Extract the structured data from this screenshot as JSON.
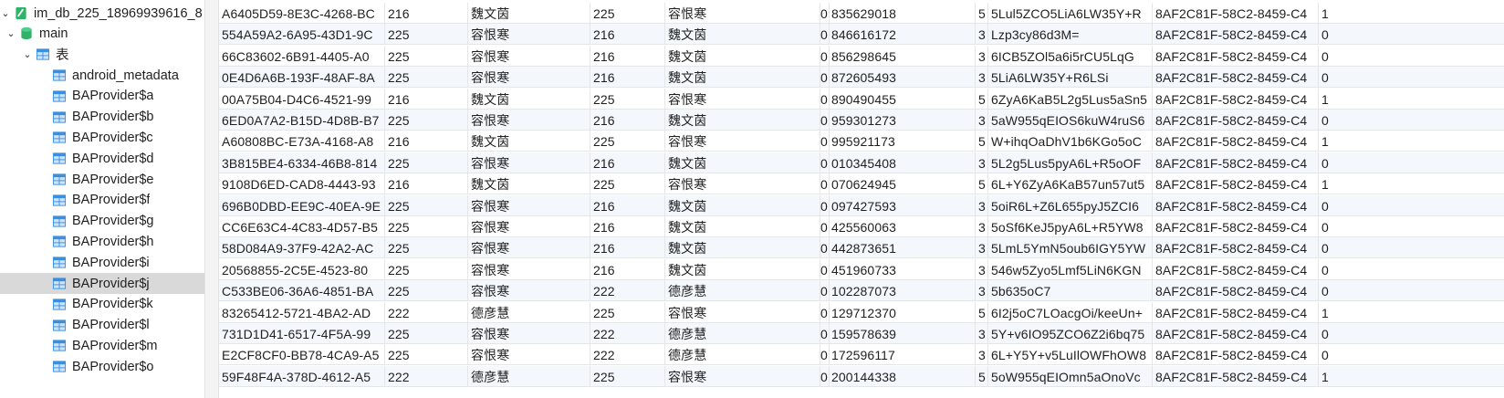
{
  "sidebar": {
    "database": "im_db_225_18969939616_8",
    "schema": "main",
    "tables_folder": "表",
    "tables": [
      "android_metadata",
      "BAProvider$a",
      "BAProvider$b",
      "BAProvider$c",
      "BAProvider$d",
      "BAProvider$e",
      "BAProvider$f",
      "BAProvider$g",
      "BAProvider$h",
      "BAProvider$i",
      "BAProvider$j",
      "BAProvider$k",
      "BAProvider$l",
      "BAProvider$m",
      "BAProvider$o"
    ],
    "selected_table": "BAProvider$j"
  },
  "colors": {
    "selected_bg": "#d9d9d9",
    "alt_row_bg": "#f4f7fb",
    "db_icon": "#2fb36b",
    "table_icon": "#3b8fe0"
  },
  "rows": [
    [
      "A6405D59-8E3C-4268-BC",
      "216",
      "魏文茵",
      "225",
      "容恨寒",
      "0",
      "835629018",
      "5",
      "5Lul5ZCO5LiA6LW35Y+R",
      "8AF2C81F-58C2-8459-C4",
      "1"
    ],
    [
      "554A59A2-6A95-43D1-9C",
      "225",
      "容恨寒",
      "216",
      "魏文茵",
      "0",
      "846616172",
      "3",
      "Lzp3cy86d3M=",
      "8AF2C81F-58C2-8459-C4",
      "0"
    ],
    [
      "66C83602-6B91-4405-A0",
      "225",
      "容恨寒",
      "216",
      "魏文茵",
      "0",
      "856298645",
      "3",
      "6ICB5ZOl5a6i5rCU5LqG",
      "8AF2C81F-58C2-8459-C4",
      "0"
    ],
    [
      "0E4D6A6B-193F-48AF-8A",
      "225",
      "容恨寒",
      "216",
      "魏文茵",
      "0",
      "872605493",
      "3",
      "5LiA6LW35Y+R6LSi",
      "8AF2C81F-58C2-8459-C4",
      "0"
    ],
    [
      "00A75B04-D4C6-4521-99",
      "216",
      "魏文茵",
      "225",
      "容恨寒",
      "0",
      "890490455",
      "5",
      "6ZyA6KaB5L2g5Lus5aSn5",
      "8AF2C81F-58C2-8459-C4",
      "1"
    ],
    [
      "6ED0A7A2-B15D-4D8B-B7",
      "225",
      "容恨寒",
      "216",
      "魏文茵",
      "0",
      "959301273",
      "3",
      "5aW955qEIOS6kuW4ruS6",
      "8AF2C81F-58C2-8459-C4",
      "0"
    ],
    [
      "A60808BC-E73A-4168-A8",
      "216",
      "魏文茵",
      "225",
      "容恨寒",
      "0",
      "995921173",
      "5",
      "W+ihqOaDhV1b6KGo5oC",
      "8AF2C81F-58C2-8459-C4",
      "1"
    ],
    [
      "3B815BE4-6334-46B8-814",
      "225",
      "容恨寒",
      "216",
      "魏文茵",
      "0",
      "010345408",
      "3",
      "5L2g5Lus5pyA6L+R5oOF",
      "8AF2C81F-58C2-8459-C4",
      "0"
    ],
    [
      "9108D6ED-CAD8-4443-93",
      "216",
      "魏文茵",
      "225",
      "容恨寒",
      "0",
      "070624945",
      "5",
      "6L+Y6ZyA6KaB57un57ut5",
      "8AF2C81F-58C2-8459-C4",
      "1"
    ],
    [
      "696B0DBD-EE9C-40EA-9E",
      "225",
      "容恨寒",
      "216",
      "魏文茵",
      "0",
      "097427593",
      "3",
      "5oiR6L+Z6L655pyJ5ZCI6",
      "8AF2C81F-58C2-8459-C4",
      "0"
    ],
    [
      "CC6E63C4-4C83-4D57-B5",
      "225",
      "容恨寒",
      "216",
      "魏文茵",
      "0",
      "425560063",
      "3",
      "5oSf6KeJ5pyA6L+R5YW8",
      "8AF2C81F-58C2-8459-C4",
      "0"
    ],
    [
      "58D084A9-37F9-42A2-AC",
      "225",
      "容恨寒",
      "216",
      "魏文茵",
      "0",
      "442873651",
      "3",
      "5LmL5YmN5oub6IGY5YW",
      "8AF2C81F-58C2-8459-C4",
      "0"
    ],
    [
      "20568855-2C5E-4523-80",
      "225",
      "容恨寒",
      "216",
      "魏文茵",
      "0",
      "451960733",
      "3",
      "546w5Zyo5Lmf5LiN6KGN",
      "8AF2C81F-58C2-8459-C4",
      "0"
    ],
    [
      "C533BE06-36A6-4851-BA",
      "225",
      "容恨寒",
      "222",
      "德彦慧",
      "0",
      "102287073",
      "3",
      "5b635oC7",
      "8AF2C81F-58C2-8459-C4",
      "0"
    ],
    [
      "83265412-5721-4BA2-AD",
      "222",
      "德彦慧",
      "225",
      "容恨寒",
      "0",
      "129712370",
      "5",
      "6I2j5oC7LOacgOi/keeUn+",
      "8AF2C81F-58C2-8459-C4",
      "1"
    ],
    [
      "731D1D41-6517-4F5A-99",
      "225",
      "容恨寒",
      "222",
      "德彦慧",
      "0",
      "159578639",
      "3",
      "5Y+v6IO95ZCO6Z2i6bq75",
      "8AF2C81F-58C2-8459-C4",
      "0"
    ],
    [
      "E2CF8CF0-BB78-4CA9-A5",
      "225",
      "容恨寒",
      "222",
      "德彦慧",
      "0",
      "172596117",
      "3",
      "6L+Y5Y+v5LuIlOWFhOW8",
      "8AF2C81F-58C2-8459-C4",
      "0"
    ],
    [
      "59F48F4A-378D-4612-A5",
      "222",
      "德彦慧",
      "225",
      "容恨寒",
      "0",
      "200144338",
      "5",
      "5oW955qEIOmn5aOnoVc",
      "8AF2C81F-58C2-8459-C4",
      "1"
    ]
  ]
}
